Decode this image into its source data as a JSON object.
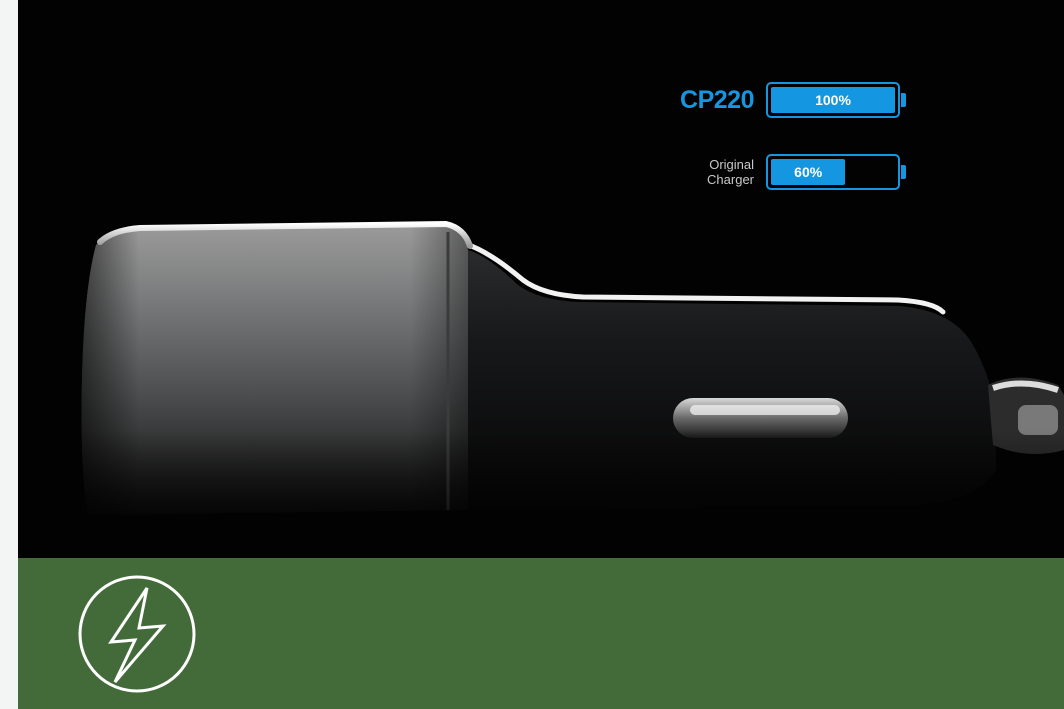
{
  "comparison": {
    "product": {
      "label": "CP220",
      "battery_level_fraction": 1.0,
      "battery_text": "100%"
    },
    "original": {
      "label_line1": "Original",
      "label_line2": "Charger",
      "battery_level_fraction": 0.6,
      "battery_text": "60%"
    }
  },
  "colors": {
    "accent_blue": "#1596e0",
    "banner_green": "#436b3a",
    "photo_background": "#020202"
  },
  "icons": {
    "banner_icon": "lightning-bolt-icon"
  }
}
